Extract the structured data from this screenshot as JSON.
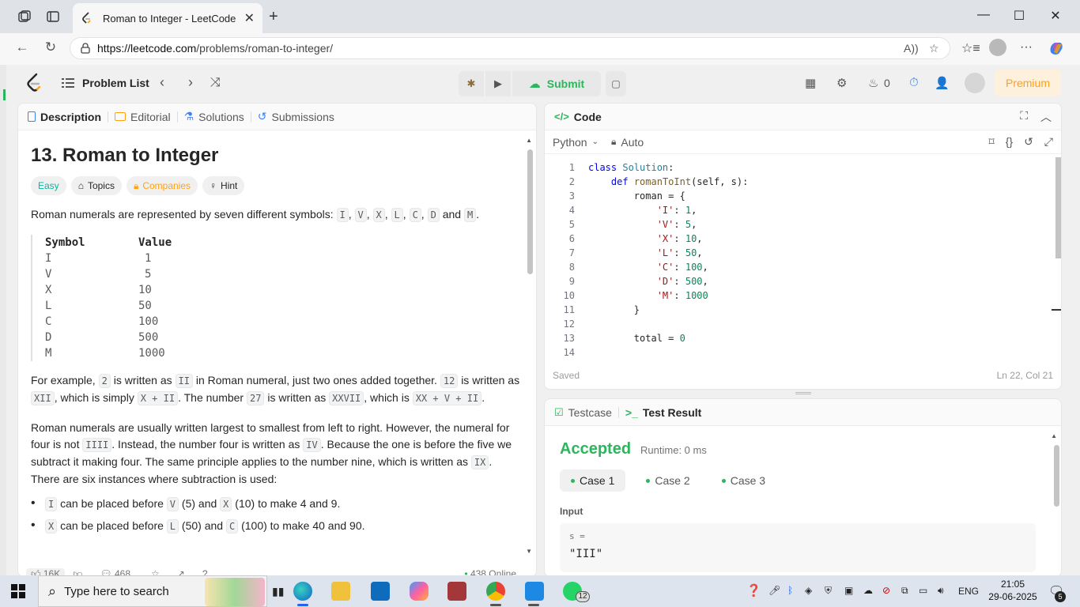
{
  "browser": {
    "tab_title": "Roman to Integer - LeetCode",
    "url_host": "https://leetcode.com",
    "url_path": "/problems/roman-to-integer/"
  },
  "nav": {
    "problem_list": "Problem List",
    "submit": "Submit",
    "fire_count": "0",
    "premium": "Premium"
  },
  "left_tabs": [
    "Description",
    "Editorial",
    "Solutions",
    "Submissions"
  ],
  "problem": {
    "title": "13. Roman to Integer",
    "chips": [
      "Easy",
      "Topics",
      "Companies",
      "Hint"
    ],
    "intro_text": "Roman numerals are represented by seven different symbols:",
    "symbols_inline": [
      "I",
      "V",
      "X",
      "L",
      "C",
      "D",
      "M"
    ],
    "intro_and": "and",
    "table_headers": [
      "Symbol",
      "Value"
    ],
    "table_rows": [
      [
        "I",
        "1"
      ],
      [
        "V",
        "5"
      ],
      [
        "X",
        "10"
      ],
      [
        "L",
        "50"
      ],
      [
        "C",
        "100"
      ],
      [
        "D",
        "500"
      ],
      [
        "M",
        "1000"
      ]
    ],
    "example": {
      "t1": "For example,",
      "c1": "2",
      "t2": "is written as",
      "c2": "II",
      "t3": "in Roman numeral, just two ones added together.",
      "c3": "12",
      "t4": "is written as",
      "c4": "XII",
      "t5": ", which is simply",
      "c5": "X + II",
      "t6": ". The number",
      "c6": "27",
      "t7": "is written as",
      "c7": "XXVII",
      "t8": ", which is",
      "c8": "XX + V + II",
      "t9": "."
    },
    "para2": {
      "t1": "Roman numerals are usually written largest to smallest from left to right. However, the numeral for four is not",
      "c1": "IIII",
      "t2": ". Instead, the number four is written as",
      "c2": "IV",
      "t3": ". Because the one is before the five we subtract it making four. The same principle applies to the number nine, which is written as",
      "c3": "IX",
      "t4": ". There are six instances where subtraction is used:"
    },
    "rules": [
      {
        "a": "I",
        "t1": "can be placed before",
        "b": "V",
        "t2": "(5) and",
        "c": "X",
        "t3": "(10) to make 4 and 9."
      },
      {
        "a": "X",
        "t1": "can be placed before",
        "b": "L",
        "t2": "(50) and",
        "c": "C",
        "t3": "(100) to make 40 and 90."
      }
    ],
    "footer": {
      "likes": "16K",
      "comments": "468",
      "online": "438 Online"
    }
  },
  "code_panel": {
    "title": "Code",
    "language": "Python",
    "auto": "Auto",
    "status": "Saved",
    "cursor": "Ln 22, Col 21",
    "lines": [
      "class Solution:",
      "    def romanToInt(self, s):",
      "        roman = {",
      "            'I': 1,",
      "            'V': 5,",
      "            'X': 10,",
      "            'L': 50,",
      "            'C': 100,",
      "            'D': 500,",
      "            'M': 1000",
      "        }",
      "",
      "        total = 0",
      ""
    ]
  },
  "result_panel": {
    "tab_testcase": "Testcase",
    "tab_result": "Test Result",
    "status": "Accepted",
    "runtime": "Runtime: 0 ms",
    "cases": [
      "Case 1",
      "Case 2",
      "Case 3"
    ],
    "input_label": "Input",
    "var_label": "s =",
    "var_value": "\"III\""
  },
  "taskbar": {
    "search_placeholder": "Type here to search",
    "whatsapp_badge": "12",
    "lang": "ENG",
    "time": "21:05",
    "date": "29-06-2025",
    "notif_count": "5"
  },
  "colors": {
    "accent": "#ffa116",
    "success": "#2db55d",
    "easy": "#00b8a3"
  }
}
